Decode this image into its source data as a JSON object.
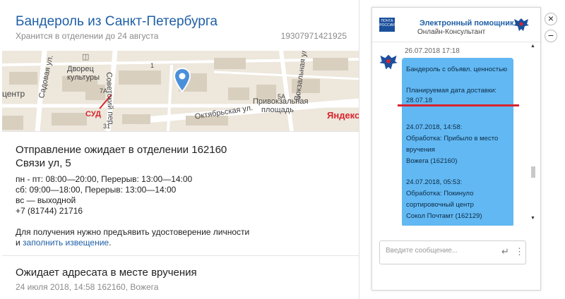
{
  "parcel": {
    "title": "Бандероль из Санкт-Петербурга",
    "stored_until": "Хранится в отделении до 24 августа",
    "tracking_number": "19307971421925"
  },
  "map": {
    "labels": {
      "culture_house_1": "Дворец",
      "culture_house_2": "культуры",
      "sadovaya": "Садовая ул.",
      "sovetsky": "Советский пер.",
      "oktyabrskaya": "Октябрьская ул.",
      "privokzalnaya_1": "Привокзальная",
      "privokzalnaya_2": "площадь",
      "vokzalnaya": "Вокзальная ул.",
      "centre": "центр",
      "court": "СУД",
      "yandex": "Яндекс",
      "house_7a": "7А",
      "house_5a": "5А",
      "house_5": "5",
      "house_31": "31",
      "house_1": "1"
    },
    "colors": {
      "court_label": "#d9232d",
      "pin": "#4a90d9"
    }
  },
  "office": {
    "status": "Отправление ожидает в отделении 162160",
    "address": "Связи ул, 5",
    "hours_weekday": "пн - пт: 08:00—20:00, Перерыв: 13:00—14:00",
    "hours_saturday": "сб: 09:00—18:00, Перерыв: 13:00—14:00",
    "hours_sunday": "вс — выходной",
    "phone": "+7 (81744) 21716",
    "id_note": "Для получения нужно предъявить удостоверение личности",
    "and": "и",
    "fill_notice_link": "заполнить извещение",
    "period": "."
  },
  "delivery": {
    "status": "Ожидает адресата в месте вручения",
    "detail": "24 июля 2018, 14:58 162160, Вожега"
  },
  "chat": {
    "logo_text": "ПОЧТА РОССИИ",
    "title": "Электронный помощник",
    "subtitle": "Онлайн-Консультант",
    "message_time": "26.07.2018 17:18",
    "lines": [
      "Бандероль с объявл. ценностью",
      "Планируемая дата доставки:",
      "28.07.18",
      "24.07.2018, 14:58:",
      "Обработка: Прибыло в место",
      "вручения",
      "Вожега (162160)",
      "24.07.2018, 05:53:",
      "Обработка: Покинуло",
      "сортировочный центр",
      "Сокол Почтамт (162129)"
    ],
    "input_placeholder": "Введите сообщение...",
    "accent_color": "#62b8f2",
    "highlight_color": "#d9232d"
  },
  "controls": {
    "close_symbol": "×",
    "minimize_symbol": "−"
  }
}
